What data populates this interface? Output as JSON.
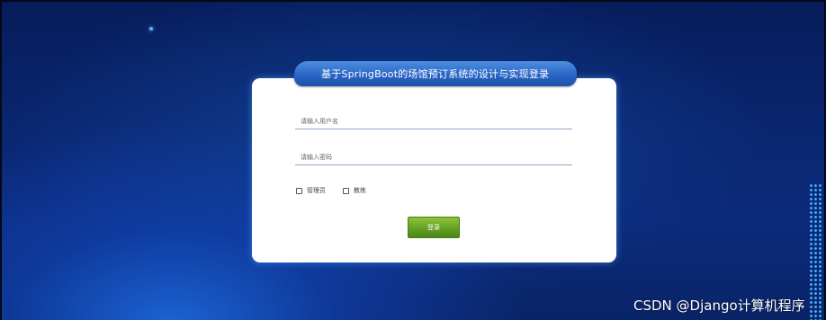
{
  "page": {
    "title": "基于SpringBoot的场馆预订系统的设计与实现登录"
  },
  "form": {
    "username_placeholder": "请输入用户名",
    "password_placeholder": "请输入密码",
    "username_value": "",
    "password_value": "",
    "roles": [
      {
        "label": "管理员",
        "checked": false
      },
      {
        "label": "教练",
        "checked": false
      }
    ],
    "login_label": "登录"
  },
  "watermark": {
    "text": "CSDN @Django计算机程序"
  },
  "colors": {
    "background": "#0a2670",
    "title_tab": "#2a66c6",
    "login_button": "#64a023",
    "field_underline": "#8fa6c8"
  }
}
